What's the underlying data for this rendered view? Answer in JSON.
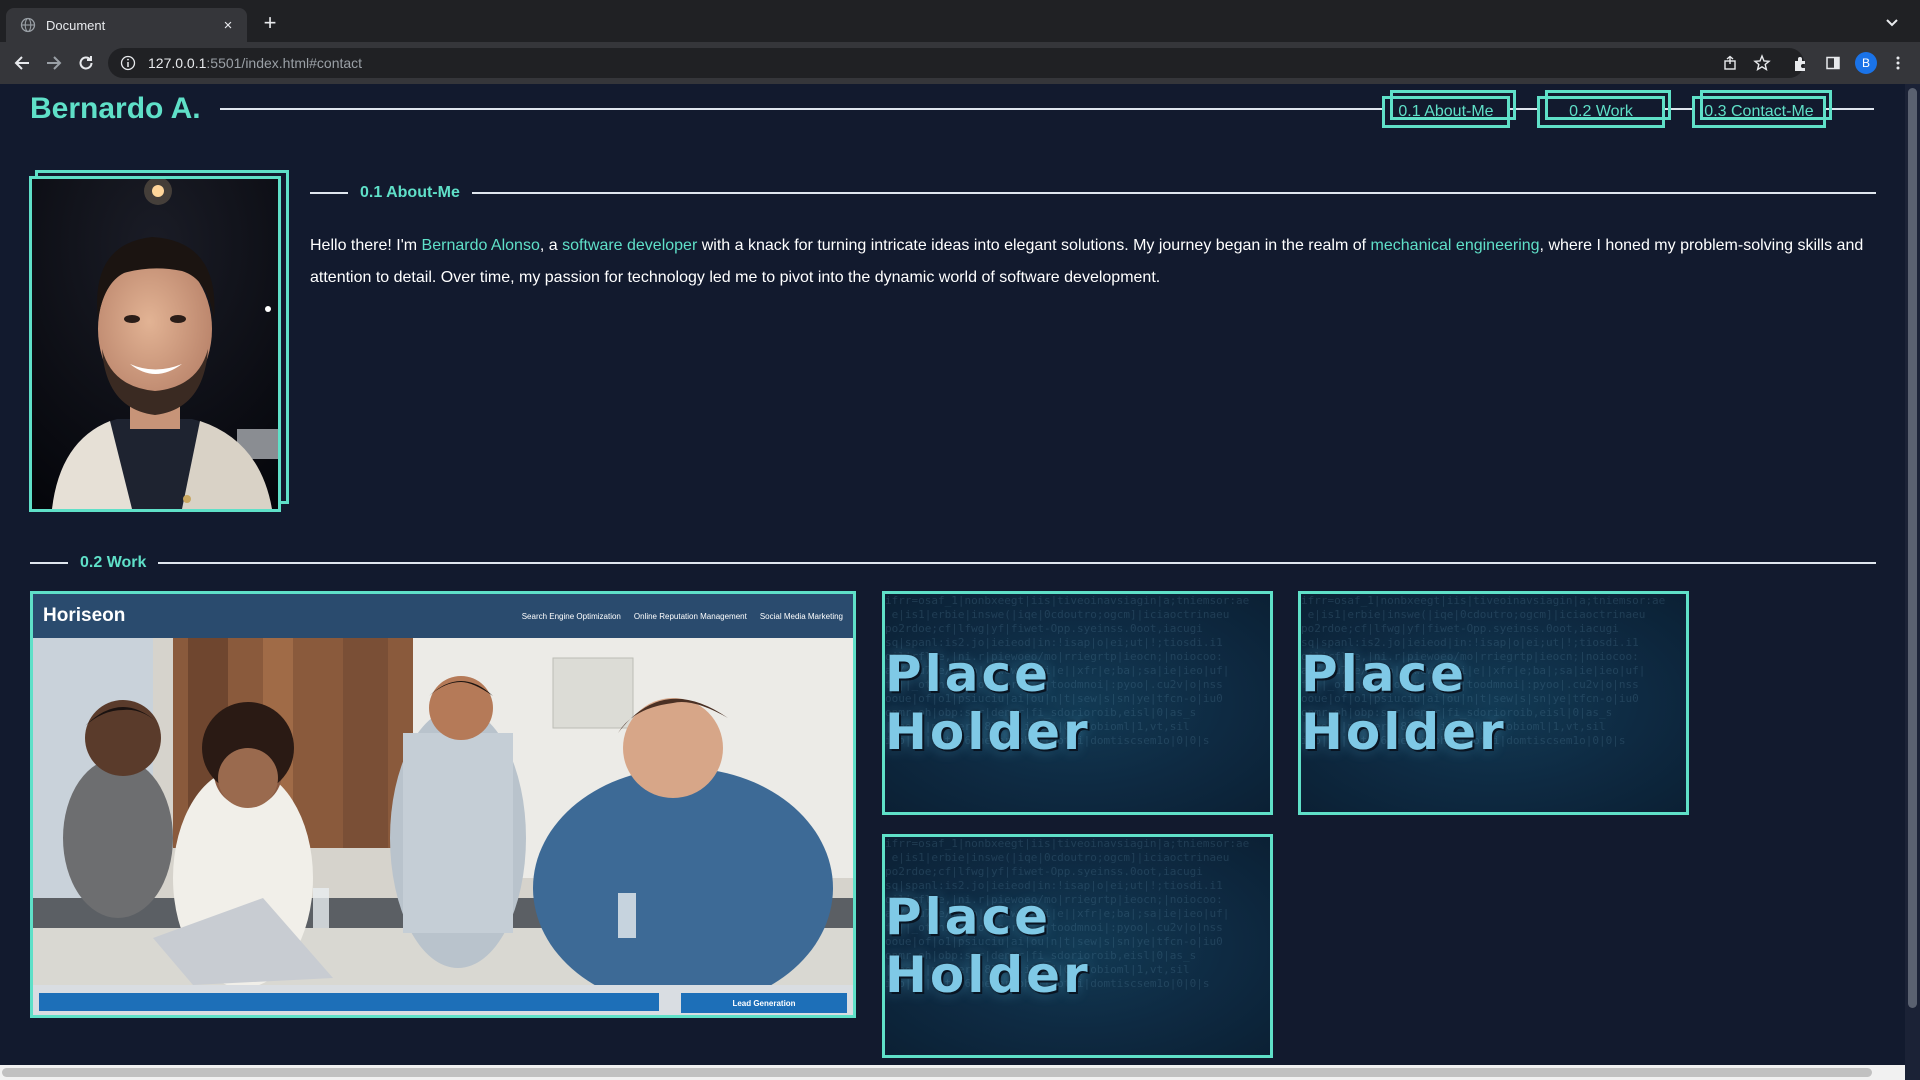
{
  "browser": {
    "tab_title": "Document",
    "tab_close": "×",
    "new_tab": "+",
    "url_host": "127.0.0.1",
    "url_rest": ":5501/index.html#contact",
    "profile_initial": "B"
  },
  "site": {
    "title": "Bernardo A.",
    "nav": [
      "0.1 About-Me",
      "0.2 Work",
      "0.3 Contact-Me"
    ]
  },
  "about": {
    "heading": "0.1 About-Me",
    "text": {
      "p1": "Hello there! I'm ",
      "name": "Bernardo Alonso",
      "p2": ", a ",
      "role": "software developer",
      "p3": " with a knack for turning intricate ideas into elegant solutions. My journey began in the realm of ",
      "field": "mechanical engineering",
      "p4": ", where I honed my problem-solving skills and attention to detail. Over time, my passion for technology led me to pivot into the dynamic world of software development."
    }
  },
  "work": {
    "heading": "0.2 Work",
    "featured": {
      "logo": "Horiseon",
      "nav": [
        "Search Engine Optimization",
        "Online Reputation Management",
        "Social Media Marketing"
      ],
      "cta": "Lead Generation"
    },
    "placeholders": [
      "Place Holder",
      "Place Holder",
      "Place Holder"
    ]
  },
  "colors": {
    "accent": "#5fe0c8",
    "page_bg": "#121a2e",
    "text": "#ffffff"
  }
}
